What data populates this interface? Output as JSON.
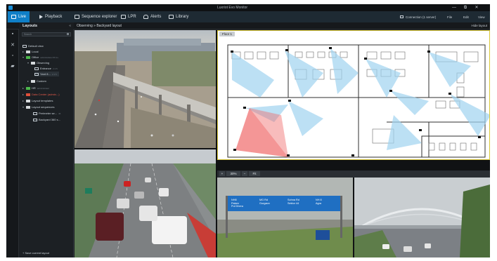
{
  "app": {
    "title": "Luxriot Evo Monitor"
  },
  "window_controls": {
    "minimize": "—",
    "restore": "⧉",
    "close": "✕"
  },
  "nav": {
    "tabs": [
      {
        "label": "Live",
        "icon": "monitor-icon",
        "active": true
      },
      {
        "label": "Playback",
        "icon": "play-icon",
        "active": false
      },
      {
        "label": "Sequence explorer",
        "icon": "sequence-icon",
        "active": false
      },
      {
        "label": "LPR",
        "icon": "car-icon",
        "active": false
      },
      {
        "label": "Alerts",
        "icon": "bell-icon",
        "active": false
      },
      {
        "label": "Library",
        "icon": "library-icon",
        "active": false
      }
    ],
    "connection": "Connection (1 server)",
    "file": "File",
    "edit": "Edit",
    "view": "View"
  },
  "subbar": {
    "breadcrumb": "Observing » Backyard layout",
    "right_label": "Hide layout"
  },
  "layouts_panel": {
    "title": "Layouts",
    "search_placeholder": "Search",
    "tree": [
      {
        "label": "Default view",
        "level": 0,
        "type": "layout"
      },
      {
        "label": "Local",
        "level": 0,
        "type": "folder",
        "color": "white"
      },
      {
        "label": "Office",
        "sub": "administrator 66 2+",
        "level": 0,
        "type": "folder",
        "color": "green"
      },
      {
        "label": "Observing",
        "level": 1,
        "type": "folder",
        "color": "white"
      },
      {
        "label": "Entrance",
        "sub": "2 4 5",
        "level": 2,
        "type": "layout"
      },
      {
        "label": "Yard 8...",
        "sub": "2 4 5",
        "level": 2,
        "type": "layout",
        "selected": true
      },
      {
        "label": "Custom",
        "level": 1,
        "type": "folder",
        "color": "white"
      },
      {
        "label": "HR",
        "sub": "administrator",
        "level": 0,
        "type": "folder",
        "color": "green"
      },
      {
        "label": "Data Center (admin...)",
        "level": 0,
        "type": "folder",
        "color": "red"
      },
      {
        "label": "Layout templates",
        "level": 0,
        "type": "folder",
        "color": "white"
      },
      {
        "label": "Layout sequences",
        "level": 0,
        "type": "folder",
        "color": "white"
      },
      {
        "label": "Perimeter se...",
        "sub": "45",
        "level": 1,
        "type": "layout"
      },
      {
        "label": "Backyard 360 s...",
        "level": 1,
        "type": "layout"
      }
    ],
    "save_label": "+ Save current layout"
  },
  "map": {
    "tab_label": "Floor 1",
    "zoom_label": "30%",
    "fit_label": "Fit"
  },
  "colors": {
    "accent": "#0f7fc7",
    "map_border": "#d9c83b",
    "fov_blue": "#9fd3f0",
    "fov_red": "#ef6a6a",
    "sign_blue": "#1f6fc2"
  },
  "sign": {
    "left": {
      "line1": "NH8",
      "line2": "Palam",
      "line3": "Pul Dhera"
    },
    "middle": {
      "line1": "MG Rd",
      "line2": "Gurgaon"
    },
    "right": {
      "line1": "Sohna Rd",
      "line2": "Sektor 44"
    },
    "far_right": {
      "line1": "NH 8",
      "line2": "Agra"
    }
  }
}
